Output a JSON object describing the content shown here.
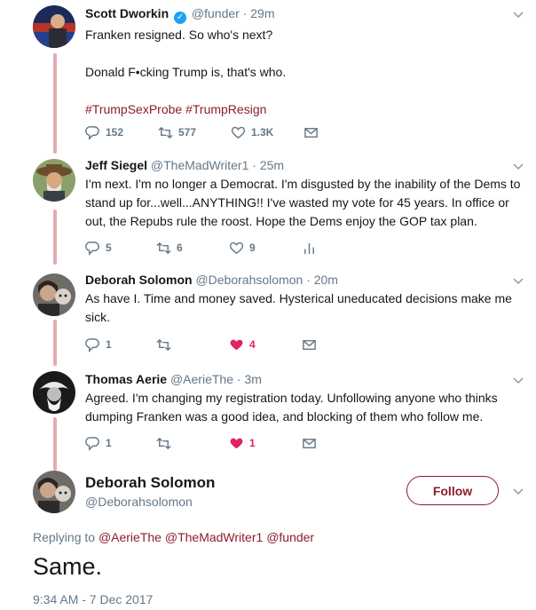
{
  "tweets": [
    {
      "name": "Scott Dworkin",
      "verified": true,
      "handle": "@funder",
      "time": "· 29m",
      "lines": [
        "Franken resigned. So who's next?",
        "",
        "Donald F•cking Trump is, that's who.",
        ""
      ],
      "hashtags": [
        "#TrumpSexProbe",
        "#TrumpResign"
      ],
      "reply_count": "152",
      "retweet_count": "577",
      "like_count": "1.3K"
    },
    {
      "name": "Jeff Siegel",
      "handle": "@TheMadWriter1",
      "time": "· 25m",
      "text": "I'm next. I'm no longer a Democrat. I'm disgusted by the inability of the Dems to stand up for...well...ANYTHING!! I've wasted my vote for 45 years. In office or out, the Repubs rule the roost. Hope the Dems enjoy the GOP tax plan.",
      "reply_count": "5",
      "retweet_count": "6",
      "like_count": "9"
    },
    {
      "name": "Deborah Solomon",
      "handle": "@Deborahsolomon",
      "time": "· 20m",
      "text": "As have I.  Time and money saved.  Hysterical uneducated decisions make me sick.",
      "reply_count": "1",
      "retweet_count": "",
      "like_count": "4"
    },
    {
      "name": "Thomas Aerie",
      "handle": "@AerieThe",
      "time": "· 3m",
      "text": "Agreed. I'm changing my registration today. Unfollowing anyone who thinks dumping Franken was a good idea, and blocking of them who follow me.",
      "reply_count": "1",
      "retweet_count": "",
      "like_count": "1"
    }
  ],
  "focused": {
    "name": "Deborah Solomon",
    "handle": "@Deborahsolomon",
    "follow_label": "Follow",
    "replying_prefix": "Replying to",
    "replying_to": [
      "@AerieThe",
      "@TheMadWriter1",
      "@funder"
    ],
    "text": "Same.",
    "timestamp": "9:34 AM - 7 Dec 2017"
  },
  "colors": {
    "accent": "#8e1c2b",
    "like": "#e0245e",
    "thread_line": "#e4aab2",
    "muted": "#657786",
    "verified": "#1da1f2"
  }
}
